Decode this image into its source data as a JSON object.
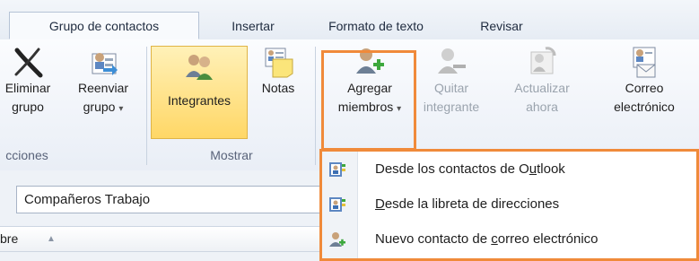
{
  "tabs": [
    {
      "label": "Grupo de contactos",
      "active": true
    },
    {
      "label": "Insertar",
      "active": false
    },
    {
      "label": "Formato de texto",
      "active": false
    },
    {
      "label": "Revisar",
      "active": false
    }
  ],
  "ribbon": {
    "acciones": {
      "label": "cciones",
      "eliminar": {
        "line1": "Eliminar",
        "line2": "grupo",
        "icon": "delete-x-icon"
      },
      "reenviar": {
        "line1": "Reenviar",
        "line2": "grupo",
        "dropdown": "▾",
        "icon": "forward-icon"
      }
    },
    "mostrar": {
      "label": "Mostrar",
      "integrantes": {
        "line1": "Integrantes",
        "icon": "members-icon",
        "selected": true
      },
      "notas": {
        "line1": "Notas",
        "icon": "notes-icon"
      }
    },
    "agregar": {
      "line1": "Agregar",
      "line2": "miembros",
      "dropdown": "▾",
      "icon": "add-member-icon"
    },
    "quitar": {
      "line1": "Quitar",
      "line2": "integrante",
      "icon": "remove-member-icon",
      "disabled": true
    },
    "actualizar": {
      "line1": "Actualizar",
      "line2": "ahora",
      "icon": "refresh-members-icon",
      "disabled": true
    },
    "correo": {
      "line1": "Correo",
      "line2": "electrónico",
      "icon": "email-icon"
    },
    "highlight_color": "#f08a3a"
  },
  "name_field": {
    "value": "Compañeros Trabajo"
  },
  "column_header": {
    "label": "bre",
    "sort_indicator": "▲"
  },
  "dropdown_menu": {
    "items": [
      {
        "pre": "Desde los contactos de O",
        "u": "u",
        "post": "tlook",
        "icon": "address-book-icon"
      },
      {
        "pre": "",
        "u": "D",
        "post": "esde la libreta de direcciones",
        "icon": "address-book-icon"
      },
      {
        "pre": "Nuevo contacto de ",
        "u": "c",
        "post": "orreo electrónico",
        "icon": "new-contact-icon"
      }
    ]
  }
}
